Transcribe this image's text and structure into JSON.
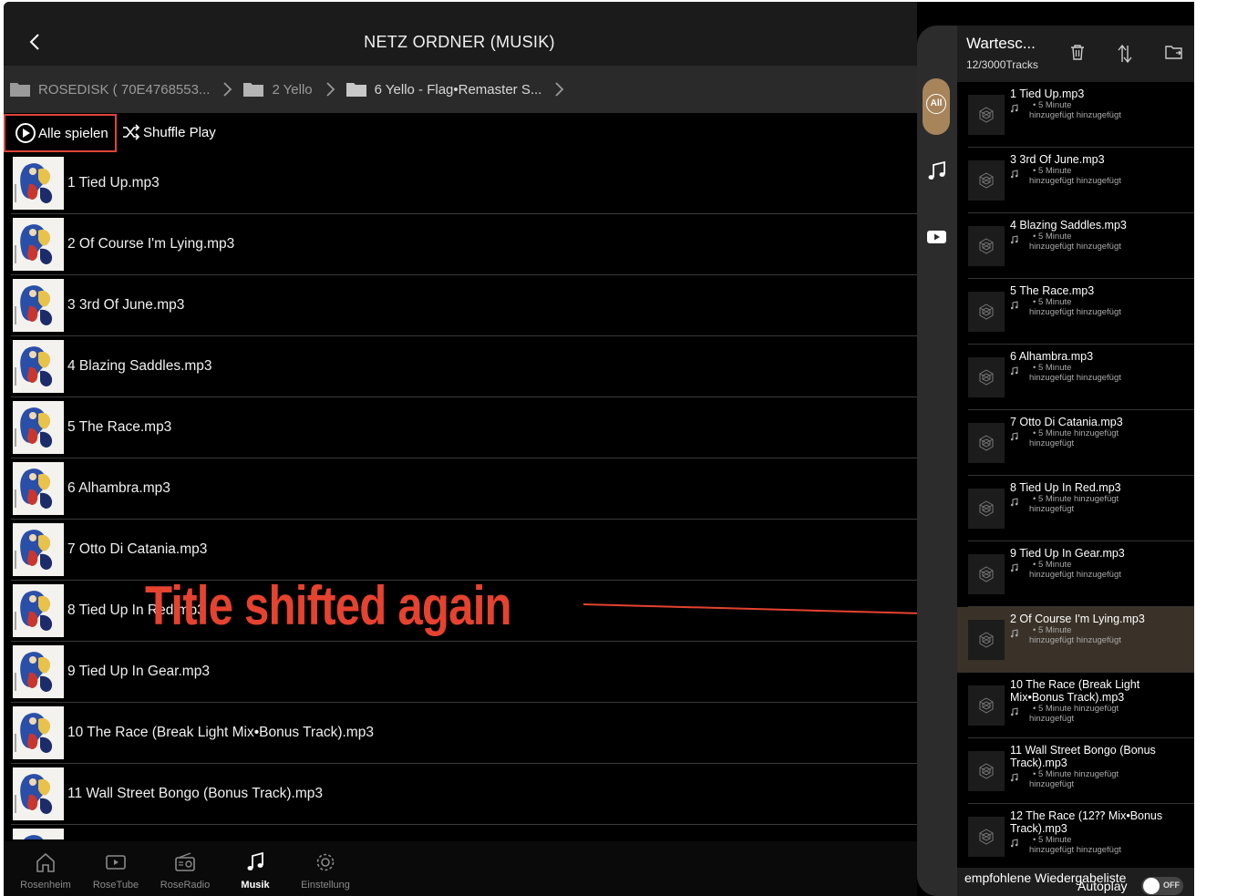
{
  "header": {
    "title": "NETZ ORDNER (MUSIK)"
  },
  "breadcrumb": [
    {
      "label": "ROSEDISK ( 70E4768553..."
    },
    {
      "label": "2 Yello"
    },
    {
      "label": "6 Yello - Flag•Remaster S..."
    }
  ],
  "actions": {
    "play_all": "Alle spielen",
    "shuffle": "Shuffle Play"
  },
  "tracks": [
    "1 Tied Up.mp3",
    "2 Of Course I'm Lying.mp3",
    "3 3rd Of June.mp3",
    "4 Blazing Saddles.mp3",
    "5 The Race.mp3",
    "6 Alhambra.mp3",
    "7 Otto Di Catania.mp3",
    "8 Tied Up In Red.mp3",
    "9 Tied Up In Gear.mp3",
    "10 The Race (Break Light Mix•Bonus Track).mp3",
    "11 Wall Street Bongo (Bonus Track).mp3"
  ],
  "annotation": {
    "text": "Title shifted again",
    "color": "#e5422f"
  },
  "bottom_nav": [
    {
      "label": "Rosenheim",
      "icon": "home-icon"
    },
    {
      "label": "RoseTube",
      "icon": "play-box-icon"
    },
    {
      "label": "RoseRadio",
      "icon": "radio-icon"
    },
    {
      "label": "Musik",
      "icon": "music-note-icon",
      "active": true
    },
    {
      "label": "Einstellung",
      "icon": "gear-icon"
    }
  ],
  "side_strip": {
    "all_label": "All"
  },
  "queue": {
    "title": "Wartesc...",
    "count": "12/3000Tracks",
    "items": [
      {
        "title": "1 Tied Up.mp3",
        "duration": "• 5 Minute",
        "added": "hinzugefügt hinzugefügt"
      },
      {
        "title": "3 3rd Of June.mp3",
        "duration": "• 5 Minute",
        "added": "hinzugefügt hinzugefügt"
      },
      {
        "title": "4 Blazing Saddles.mp3",
        "duration": "• 5 Minute",
        "added": "hinzugefügt hinzugefügt"
      },
      {
        "title": "5 The Race.mp3",
        "duration": "• 5 Minute",
        "added": "hinzugefügt hinzugefügt"
      },
      {
        "title": "6 Alhambra.mp3",
        "duration": "• 5 Minute",
        "added": "hinzugefügt hinzugefügt"
      },
      {
        "title": "7 Otto Di Catania.mp3",
        "duration": "• 5 Minute hinzugefügt",
        "added": "hinzugefügt"
      },
      {
        "title": "8 Tied Up In Red.mp3",
        "duration": "• 5 Minute hinzugefügt",
        "added": "hinzugefügt"
      },
      {
        "title": "9 Tied Up In Gear.mp3",
        "duration": "• 5 Minute",
        "added": "hinzugefügt hinzugefügt"
      },
      {
        "title": "2 Of Course I'm Lying.mp3",
        "duration": "• 5 Minute",
        "added": "hinzugefügt hinzugefügt",
        "highlight": true
      },
      {
        "title": "10 The Race (Break Light Mix•Bonus Track).mp3",
        "duration": "• 5 Minute hinzugefügt",
        "added": "hinzugefügt"
      },
      {
        "title": "11 Wall Street Bongo (Bonus Track).mp3",
        "duration": "• 5 Minute hinzugefügt",
        "added": "hinzugefügt"
      },
      {
        "title": "12 The Race (12⁇ Mix•Bonus Track).mp3",
        "duration": "• 5 Minute",
        "added": "hinzugefügt hinzugefügt"
      }
    ],
    "footer": {
      "recommended": "empfohlene Wiedergabeliste",
      "autoplay": "Autoplay",
      "toggle_state": "OFF"
    }
  },
  "colors": {
    "accent": "#a7845a",
    "annotation": "#e5422f",
    "highlight_row": "#3a3228"
  }
}
